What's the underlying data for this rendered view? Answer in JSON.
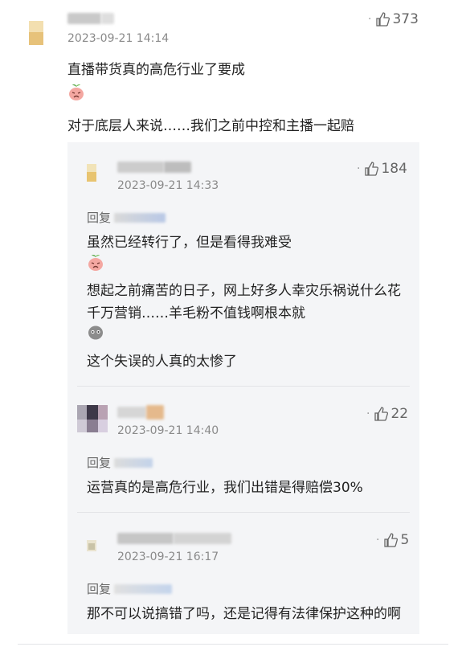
{
  "main_comment": {
    "date": "2023-09-21 14:14",
    "likes": "373",
    "line1": "直播带货真的高危行业了要成",
    "line2": "对于底层人来说……我们之前中控和主播一起赔"
  },
  "replies": [
    {
      "date": "2023-09-21 14:33",
      "likes": "184",
      "reply_label": "回复",
      "line1": "虽然已经转行了，但是看得我难受",
      "line2": "想起之前痛苦的日子，网上好多人幸灾乐祸说什么花",
      "line3": "千万营销……羊毛粉不值钱啊根本就",
      "line4": "这个失误的人真的太惨了"
    },
    {
      "date": "2023-09-21 14:40",
      "likes": "22",
      "reply_label": "回复",
      "line1": "运营真的是高危行业，我们出错是得赔偿30%"
    },
    {
      "date": "2023-09-21 16:17",
      "likes": "5",
      "reply_label": "回复",
      "line1": "那不可以说搞错了吗，还是记得有法律保护这种的啊"
    }
  ],
  "icons": {
    "like": "thumbs-up-icon",
    "emoji_sad": "sad-sprout-emoji",
    "emoji_grey": "grey-blob-emoji"
  },
  "colors": {
    "reply_background": "#f4f5f7",
    "meta_text": "#8a8a8a"
  }
}
